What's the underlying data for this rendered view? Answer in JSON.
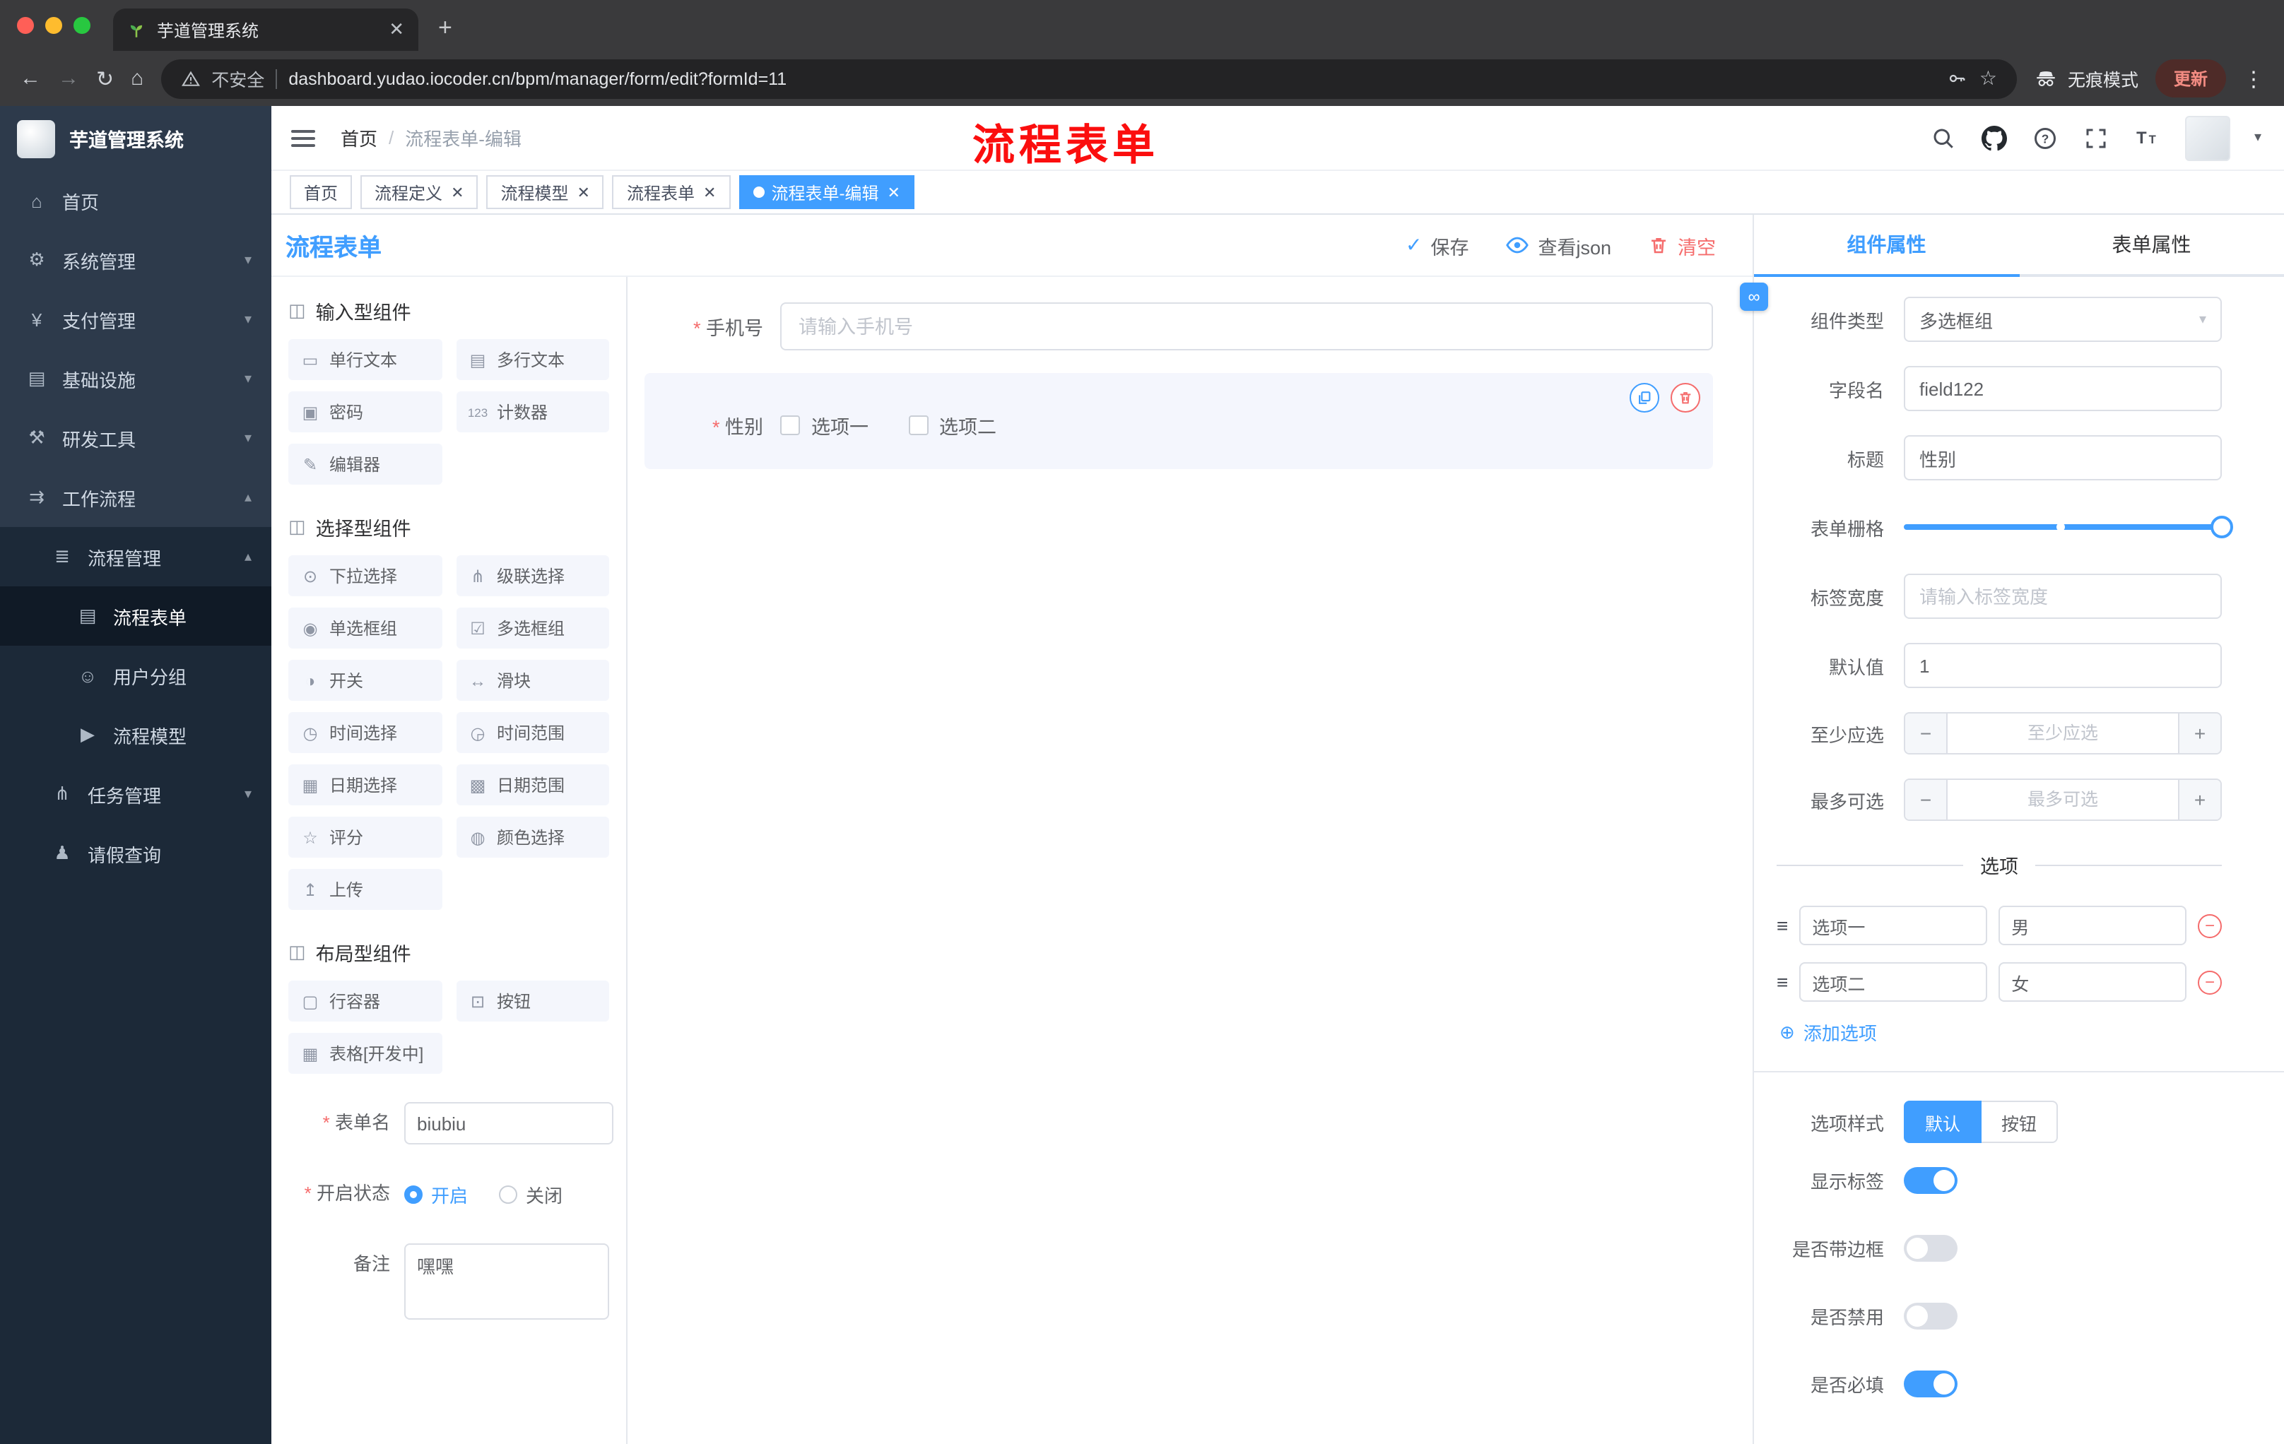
{
  "colors": {
    "accent": "#409eff",
    "danger": "#f56c6c",
    "annotation_red": "#fb0e0e",
    "sidebar_bg": "#2d3a4b",
    "sidebar_submenu_bg": "#1c2938",
    "chrome_bg": "#3a3a3c",
    "active_tag_bg": "#409eff"
  },
  "browser": {
    "tab_title": "芋道管理系统",
    "security_label": "不安全",
    "url": "dashboard.yudao.iocoder.cn/bpm/manager/form/edit?formId=11",
    "incognito_label": "无痕模式",
    "update_label": "更新"
  },
  "sidebar": {
    "logo_title": "芋道管理系统",
    "menu": [
      {
        "label": "首页",
        "name": "home",
        "icon": "home-icon",
        "glyph": "⌂",
        "level": 1
      },
      {
        "label": "系统管理",
        "name": "system-management",
        "icon": "gear-icon",
        "glyph": "⚙",
        "level": 1,
        "arrow": "down"
      },
      {
        "label": "支付管理",
        "name": "payment-management",
        "icon": "yen-icon",
        "glyph": "¥",
        "level": 1,
        "arrow": "down"
      },
      {
        "label": "基础设施",
        "name": "infrastructure",
        "icon": "monitor-icon",
        "glyph": "▤",
        "level": 1,
        "arrow": "down"
      },
      {
        "label": "研发工具",
        "name": "dev-tools",
        "icon": "tools-icon",
        "glyph": "⚒",
        "level": 1,
        "arrow": "down"
      },
      {
        "label": "工作流程",
        "name": "workflow",
        "icon": "workflow-icon",
        "glyph": "⇉",
        "level": 1,
        "arrow": "up"
      },
      {
        "label": "流程管理",
        "name": "process-management",
        "icon": "list-icon",
        "glyph": "≣",
        "level": 2,
        "arrow": "up"
      },
      {
        "label": "流程表单",
        "name": "process-form",
        "icon": "document-icon",
        "glyph": "▤",
        "level": 3,
        "active": true
      },
      {
        "label": "用户分组",
        "name": "user-group",
        "icon": "users-icon",
        "glyph": "☺",
        "level": 3
      },
      {
        "label": "流程模型",
        "name": "process-model",
        "icon": "send-icon",
        "glyph": "▶",
        "level": 3
      },
      {
        "label": "任务管理",
        "name": "task-management",
        "icon": "branch-icon",
        "glyph": "⋔",
        "level": 2,
        "arrow": "down"
      },
      {
        "label": "请假查询",
        "name": "leave-query",
        "icon": "person-icon",
        "glyph": "♟",
        "level": 2
      }
    ]
  },
  "header": {
    "breadcrumb_home": "首页",
    "breadcrumb_current": "流程表单-编辑",
    "annotation": "流程表单"
  },
  "tags": [
    {
      "label": "首页",
      "name": "home"
    },
    {
      "label": "流程定义",
      "name": "process-definition",
      "closable": true
    },
    {
      "label": "流程模型",
      "name": "process-model",
      "closable": true
    },
    {
      "label": "流程表单",
      "name": "process-form",
      "closable": true
    },
    {
      "label": "流程表单-编辑",
      "name": "process-form-edit",
      "closable": true,
      "active": true
    }
  ],
  "designer": {
    "title": "流程表单",
    "actions": {
      "save": "保存",
      "view_json": "查看json",
      "clear": "清空"
    },
    "palette": [
      {
        "group": "输入型组件",
        "items": [
          {
            "label": "单行文本",
            "name": "single-line-text",
            "icon": "single-line-text-icon",
            "glyph": "▭"
          },
          {
            "label": "多行文本",
            "name": "multi-line-text",
            "icon": "multi-line-text-icon",
            "glyph": "▤"
          },
          {
            "label": "密码",
            "name": "password",
            "icon": "password-lock-icon",
            "glyph": "▣"
          },
          {
            "label": "计数器",
            "name": "counter",
            "icon": "counter-123-icon",
            "glyph": "123"
          },
          {
            "label": "编辑器",
            "name": "editor",
            "icon": "editor-pencil-icon",
            "glyph": "✎"
          }
        ]
      },
      {
        "group": "选择型组件",
        "items": [
          {
            "label": "下拉选择",
            "name": "select",
            "icon": "dropdown-icon",
            "glyph": "⊙"
          },
          {
            "label": "级联选择",
            "name": "cascader",
            "icon": "cascade-icon",
            "glyph": "⋔"
          },
          {
            "label": "单选框组",
            "name": "radio-group",
            "icon": "radio-icon",
            "glyph": "◉"
          },
          {
            "label": "多选框组",
            "name": "checkbox-group",
            "icon": "checkbox-icon",
            "glyph": "☑"
          },
          {
            "label": "开关",
            "name": "switch",
            "icon": "switch-icon",
            "glyph": "◑"
          },
          {
            "label": "滑块",
            "name": "slider",
            "icon": "slider-icon",
            "glyph": "↔"
          },
          {
            "label": "时间选择",
            "name": "time-picker",
            "icon": "clock-icon",
            "glyph": "◷"
          },
          {
            "label": "时间范围",
            "name": "time-range",
            "icon": "clock-range-icon",
            "glyph": "◶"
          },
          {
            "label": "日期选择",
            "name": "date-picker",
            "icon": "calendar-icon",
            "glyph": "▦"
          },
          {
            "label": "日期范围",
            "name": "date-range",
            "icon": "calendar-range-icon",
            "glyph": "▩"
          },
          {
            "label": "评分",
            "name": "rate",
            "icon": "star-icon",
            "glyph": "☆"
          },
          {
            "label": "颜色选择",
            "name": "color-picker",
            "icon": "color-icon",
            "glyph": "◍"
          },
          {
            "label": "上传",
            "name": "upload",
            "icon": "upload-icon",
            "glyph": "↥"
          }
        ]
      },
      {
        "group": "布局型组件",
        "items": [
          {
            "label": "行容器",
            "name": "row-container",
            "icon": "row-container-icon",
            "glyph": "▢"
          },
          {
            "label": "按钮",
            "name": "button",
            "icon": "button-icon",
            "glyph": "⊡"
          },
          {
            "label": "表格[开发中]",
            "name": "table",
            "icon": "table-icon",
            "glyph": "▦"
          }
        ]
      }
    ],
    "meta": {
      "form_name_label": "表单名",
      "form_name_value": "biubiu",
      "status_label": "开启状态",
      "status_on": "开启",
      "status_off": "关闭",
      "remark_label": "备注",
      "remark_value": "嘿嘿"
    }
  },
  "canvas": {
    "fields": [
      {
        "type": "input",
        "label": "手机号",
        "required": true,
        "placeholder": "请输入手机号"
      },
      {
        "type": "checkbox-group",
        "label": "性别",
        "required": true,
        "selected": true,
        "options": [
          "选项一",
          "选项二"
        ]
      }
    ]
  },
  "props": {
    "tabs": [
      {
        "label": "组件属性",
        "name": "component-props",
        "active": true
      },
      {
        "label": "表单属性",
        "name": "form-props"
      }
    ],
    "rows": {
      "component_type": {
        "label": "组件类型",
        "value": "多选框组"
      },
      "field_name": {
        "label": "字段名",
        "value": "field122"
      },
      "title": {
        "label": "标题",
        "value": "性别"
      },
      "grid": {
        "label": "表单栅格",
        "value_percent": 100,
        "mark_percent": 48
      },
      "label_width": {
        "label": "标签宽度",
        "placeholder": "请输入标签宽度"
      },
      "default_value": {
        "label": "默认值",
        "value": "1"
      },
      "min_select": {
        "label": "至少应选",
        "placeholder": "至少应选"
      },
      "max_select": {
        "label": "最多可选",
        "placeholder": "最多可选"
      }
    },
    "options_section": {
      "divider": "选项",
      "options": [
        {
          "label": "选项一",
          "value": "男"
        },
        {
          "label": "选项二",
          "value": "女"
        }
      ],
      "add_label": "添加选项"
    },
    "style_section": {
      "option_style_label": "选项样式",
      "styles": [
        {
          "label": "默认",
          "name": "default",
          "active": true
        },
        {
          "label": "按钮",
          "name": "button"
        }
      ],
      "switches": [
        {
          "label": "显示标签",
          "name": "show-label",
          "on": true
        },
        {
          "label": "是否带边框",
          "name": "with-border",
          "on": false
        },
        {
          "label": "是否禁用",
          "name": "disabled",
          "on": false
        },
        {
          "label": "是否必填",
          "name": "required",
          "on": true
        }
      ]
    }
  }
}
